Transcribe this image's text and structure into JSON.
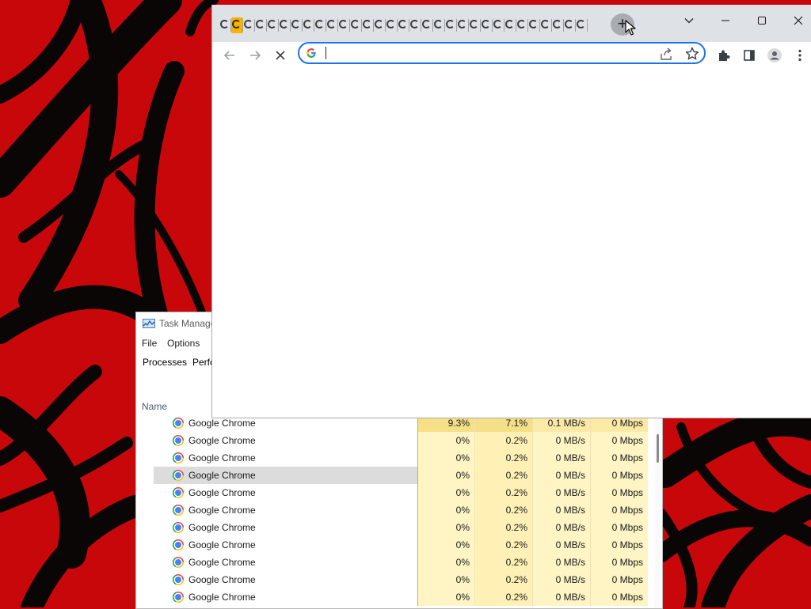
{
  "taskmgr": {
    "title": "Task Manage",
    "menu": [
      "File",
      "Options"
    ],
    "tabs": [
      "Processes",
      "Perfo"
    ],
    "name_header": "Name",
    "rows": [
      {
        "name": "Google Chrome",
        "cpu": "9.3%",
        "mem": "7.1%",
        "disk": "0.1 MB/s",
        "net": "0 Mbps",
        "hot": true
      },
      {
        "name": "Google Chrome",
        "cpu": "0%",
        "mem": "0.2%",
        "disk": "0 MB/s",
        "net": "0 Mbps"
      },
      {
        "name": "Google Chrome",
        "cpu": "0%",
        "mem": "0.2%",
        "disk": "0 MB/s",
        "net": "0 Mbps"
      },
      {
        "name": "Google Chrome",
        "cpu": "0%",
        "mem": "0.2%",
        "disk": "0 MB/s",
        "net": "0 Mbps",
        "selected": true
      },
      {
        "name": "Google Chrome",
        "cpu": "0%",
        "mem": "0.2%",
        "disk": "0 MB/s",
        "net": "0 Mbps"
      },
      {
        "name": "Google Chrome",
        "cpu": "0%",
        "mem": "0.2%",
        "disk": "0 MB/s",
        "net": "0 Mbps"
      },
      {
        "name": "Google Chrome",
        "cpu": "0%",
        "mem": "0.2%",
        "disk": "0 MB/s",
        "net": "0 Mbps"
      },
      {
        "name": "Google Chrome",
        "cpu": "0%",
        "mem": "0.2%",
        "disk": "0 MB/s",
        "net": "0 Mbps"
      },
      {
        "name": "Google Chrome",
        "cpu": "0%",
        "mem": "0.2%",
        "disk": "0 MB/s",
        "net": "0 Mbps"
      },
      {
        "name": "Google Chrome",
        "cpu": "0%",
        "mem": "0.2%",
        "disk": "0 MB/s",
        "net": "0 Mbps"
      },
      {
        "name": "Google Chrome",
        "cpu": "0%",
        "mem": "0.2%",
        "disk": "0 MB/s",
        "net": "0 Mbps"
      }
    ]
  },
  "chrome": {
    "tab_count": 31,
    "active_tab_index": 1,
    "icons": {
      "new_tab": "plus-icon",
      "tab_search": "chevron-down-icon",
      "minimize": "minimize-icon",
      "maximize": "maximize-icon",
      "close": "close-icon",
      "back": "back-arrow-icon",
      "forward": "forward-arrow-icon",
      "stop": "stop-loading-icon",
      "share": "share-icon",
      "bookmark": "star-icon",
      "extensions": "puzzle-icon",
      "side_panel": "side-panel-icon",
      "profile": "profile-icon",
      "menu": "kebab-menu-icon"
    },
    "omnibox": {
      "value": "",
      "placeholder": ""
    }
  },
  "colors": {
    "wallpaper_red": "#c8070a",
    "omnibox_focus": "#1a73e8",
    "active_tab": "#f6b400",
    "cpu_heat": "#fff4c4"
  }
}
